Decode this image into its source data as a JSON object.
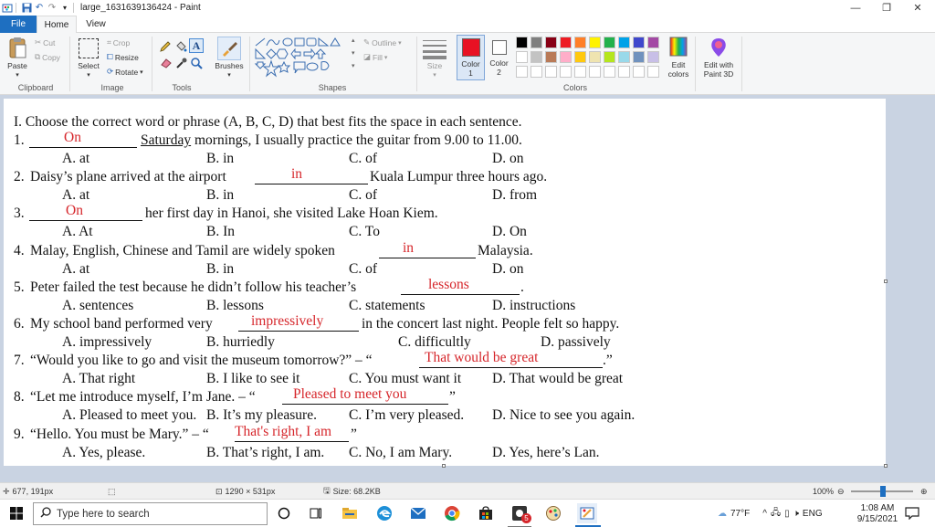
{
  "window": {
    "title": "large_1631639136424 - Paint",
    "minimize": "—",
    "restore": "❐",
    "close": "✕"
  },
  "tabs": {
    "file": "File",
    "home": "Home",
    "view": "View"
  },
  "ribbon": {
    "clipboard": {
      "label": "Clipboard",
      "paste": "Paste",
      "cut": "Cut",
      "copy": "Copy"
    },
    "image": {
      "label": "Image",
      "select": "Select",
      "crop": "Crop",
      "resize": "Resize",
      "rotate": "Rotate"
    },
    "tools": {
      "label": "Tools",
      "text_tool": "A"
    },
    "brushes": {
      "label": "Brushes"
    },
    "shapes": {
      "label": "Shapes",
      "outline": "Outline",
      "fill": "Fill"
    },
    "size": {
      "label": "Size"
    },
    "color1": {
      "label": "Color",
      "num": "1",
      "value": "#e81123"
    },
    "color2": {
      "label": "Color",
      "num": "2",
      "value": "#ffffff"
    },
    "colors": {
      "label": "Colors",
      "edit_label": "Edit",
      "edit_label2": "colors",
      "row1": [
        "#000000",
        "#7f7f7f",
        "#880015",
        "#ed1c24",
        "#ff7f27",
        "#fff200",
        "#22b14c",
        "#00a2e8",
        "#3f48cc",
        "#a349a4"
      ],
      "row2": [
        "#ffffff",
        "#c3c3c3",
        "#b97a57",
        "#ffaec9",
        "#ffc90e",
        "#efe4b0",
        "#b5e61d",
        "#99d9ea",
        "#7092be",
        "#c8bfe7"
      ]
    },
    "paint3d": {
      "label1": "Edit with",
      "label2": "Paint 3D"
    }
  },
  "document": {
    "heading": "I. Choose the correct word or phrase (A, B, C, D) that best fits the space in each sentence.",
    "questions": [
      {
        "num": "1.",
        "pre": "",
        "after_blank": "",
        "underlined": "Saturday",
        "post": " mornings, I usually practice the guitar from 9.00 to 11.00.",
        "answer": "On",
        "options": [
          "A. at",
          "B. in",
          "C. of",
          "D. on"
        ]
      },
      {
        "num": "2.",
        "pre": "Daisy’s plane arrived at the airport ",
        "post": " Kuala Lumpur three hours ago.",
        "answer": "in",
        "options": [
          "A. at",
          "B. in",
          "C. of",
          "D. from"
        ]
      },
      {
        "num": "3.",
        "pre": "",
        "post": " her first day in Hanoi, she visited Lake Hoan Kiem.",
        "answer": "On",
        "options": [
          "A. At",
          "B. In",
          "C. To",
          "D. On"
        ]
      },
      {
        "num": "4.",
        "pre": "Malay, English, Chinese and Tamil are widely spoken ",
        "post": " Malaysia.",
        "answer": "in",
        "options": [
          "A. at",
          "B. in",
          "C. of",
          "D. on"
        ]
      },
      {
        "num": "5.",
        "pre": "Peter failed the test because he didn’t follow his teacher’s ",
        "post": ".",
        "answer": "lessons",
        "options": [
          "A. sentences",
          "B. lessons",
          "C. statements",
          "D. instructions"
        ]
      },
      {
        "num": "6.",
        "pre": "My school band performed very ",
        "post": " in the concert last night. People felt so happy.",
        "answer": "impressively",
        "options": [
          "A. impressively",
          "B. hurriedly",
          "C. difficultly",
          "D. passively"
        ]
      },
      {
        "num": "7.",
        "pre": "“Would you like to go and visit the museum tomorrow?” – “",
        "post": ".”",
        "answer": "That would be great",
        "options": [
          "A. That right",
          "B. I like to see it",
          "C. You must want it",
          "D. That would be great"
        ]
      },
      {
        "num": "8.",
        "pre": "“Let me introduce myself, I’m Jane. – “",
        "post": "”",
        "answer": "Pleased to meet you",
        "options": [
          "A. Pleased to meet you.",
          "B. It’s my pleasure.",
          "C. I’m very pleased.",
          "D. Nice to see you again."
        ]
      },
      {
        "num": "9.",
        "pre": "“Hello. You must be Mary.” – “",
        "post": " ”",
        "answer": "That's right, I am",
        "options": [
          "A. Yes, please.",
          "B. That’s right, I am.",
          "C. No, I am Mary.",
          "D. Yes, here’s Lan."
        ]
      }
    ]
  },
  "status": {
    "cursor": "677, 191px",
    "selection": "",
    "image_size": "1290 × 531px",
    "file_size": "Size: 68.2KB",
    "zoom": "100%"
  },
  "taskbar": {
    "search_placeholder": "Type here to search",
    "badge": "5",
    "weather": "77°F",
    "lang": "ENG",
    "time": "1:08 AM",
    "date": "9/15/2021"
  }
}
